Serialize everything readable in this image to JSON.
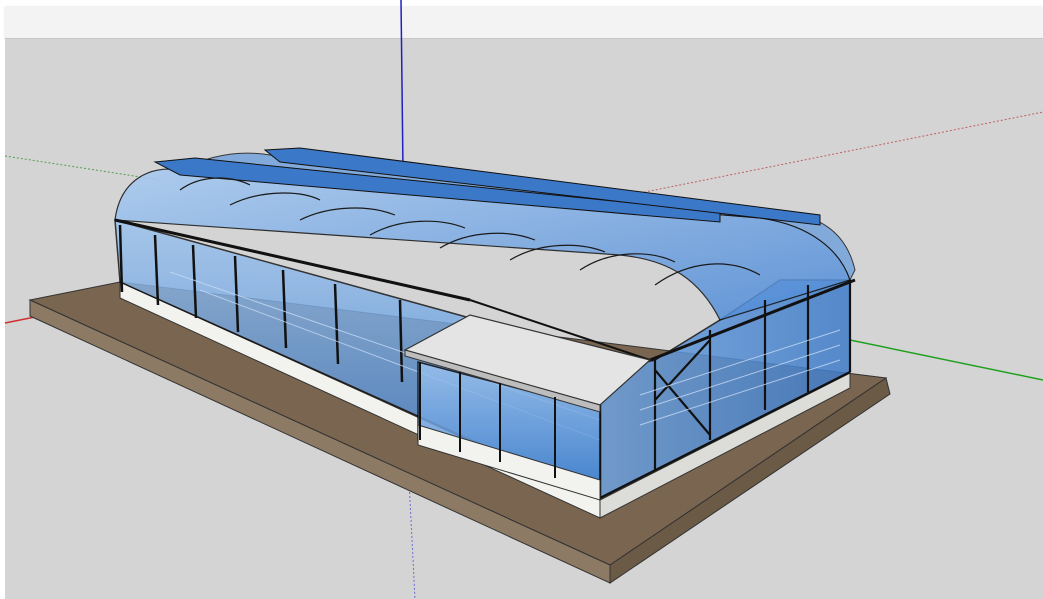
{
  "app": {
    "viewport_background": "#d4d4d4",
    "toolbar_background": "#f3f3f3"
  },
  "axes": {
    "red_color": "#d03030",
    "green_color": "#20a020",
    "blue_color": "#2020c0"
  },
  "model": {
    "glass_color": "#5b93d6",
    "frame_color": "#111111",
    "base_color": "#7a6650",
    "plinth_color": "#eeeeea"
  }
}
